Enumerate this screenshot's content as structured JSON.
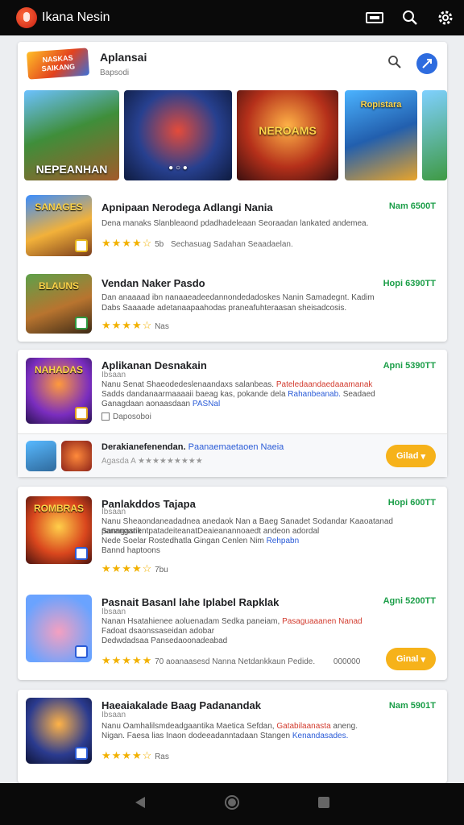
{
  "app": {
    "title": "Ikana Nesin"
  },
  "header": {
    "brand": "NASKAS SAIKANG",
    "title": "Aplansai",
    "subtitle": "Bapsodi"
  },
  "banners": [
    "NEPEANHAN",
    "",
    "NEROAMS",
    "Ropistara",
    ""
  ],
  "cards": [
    {
      "items": [
        {
          "title": "Apnipaan Nerodega Adlangi Nania",
          "price": "Nam 6500T",
          "desc": "Dena manaks Slanbleaond pdadhadeleaan Seoraadan lankated andemea.",
          "rating": "5b",
          "rating_text": "Sechasuag Sadahan Seaadaelan.",
          "stars": "★★★★☆",
          "cap": "SANAGES"
        },
        {
          "title": "Vendan Naker Pasdo",
          "price": "Hopi 6390TT",
          "desc": "Dan anaaaad ibn nanaaeadeedannondedadoskes Nanin Samadegnt. Kadim",
          "desc2": "Dabs Saaaade adetanaapaahodas praneafuhteraasan sheisadcosis.",
          "rating": "Nas",
          "stars": "★★★★☆",
          "cap": "BLAUNS"
        }
      ]
    },
    {
      "items": [
        {
          "title": "Aplikanan Desnakain",
          "price": "Apni 5390TT",
          "sub": "Ibsaan",
          "desc": "Nanu Senat Shaeodedeslenaandaxs salanbeas.",
          "desc_red": "Pateledaandaedaaamanak",
          "desc2": "Sadds dandanaarmaaaaii baeag kas, pokande dela",
          "desc2_blue": "Rahanbeanab.",
          "desc2_tail": "Seadaed",
          "desc3": "Ganagdaan aonaasdaan",
          "desc3_blue": "PASNal",
          "meta": "Daposoboi",
          "cap": "NAHADAS"
        }
      ],
      "sub": {
        "title": "Derakianefenendan.",
        "title_blue": "Paanaemaetaoen Naeia",
        "ratings": "Agasda A ★★★★★★★★★",
        "button": "Gilad"
      }
    },
    {
      "items": [
        {
          "title": "Panlakddos Tajapa",
          "price": "Hopi 600TT",
          "sub": "Ibsaan",
          "desc": "Nanu Sheaondaneadadnea anedaok Nan a Baeg Sanadet Sodandar Kaaoatanad Sanngastik",
          "desc2": "pananganentpatadeiteanatDeaieanannoaedt andeon adordal",
          "desc3": "Nede Soelar Rostedhatla Gingan Cenlen Nim",
          "desc3_blue": "Rehpabn",
          "desc4": "Bannd haptoons",
          "rating": "7bu",
          "stars": "★★★★☆",
          "cap": "ROMBRAS"
        },
        {
          "title": "Pasnait Basanl lahe Iplabel Rapklak",
          "price": "Agni 5200TT",
          "sub": "Ibsaan",
          "desc": "Nanan Hsatahienee aoluenadam Sedka paneiam,",
          "desc_red": "Pasaguaaanen Nanad",
          "desc2": "Fadoat dsaonssaseidan adobar",
          "desc3": "Dedwdadsaa Pansedaoonadeabad",
          "rating": "70 aoanaasesd Nanna Netdankkaun Pedide.",
          "rating2": "000000",
          "stars": "★★★★★",
          "button": "Ginal",
          "cap": ""
        }
      ]
    },
    {
      "items": [
        {
          "title": "Haeaiakalade Baag Padanandak",
          "price": "Nam 5901T",
          "sub": "Ibsaan",
          "desc": "Nanu Oamhalilsmdeadgaantika Maetica Sefdan,",
          "desc_red": "Gatabilaanasta",
          "desc_tail": "aneng.",
          "desc2": "Nigan. Faesa lias Inaon dodeeadanntadaan Stangen",
          "desc2_blue": "Kenandasades.",
          "rating": "Ras",
          "stars": "★★★★☆",
          "cap": ""
        }
      ]
    }
  ]
}
